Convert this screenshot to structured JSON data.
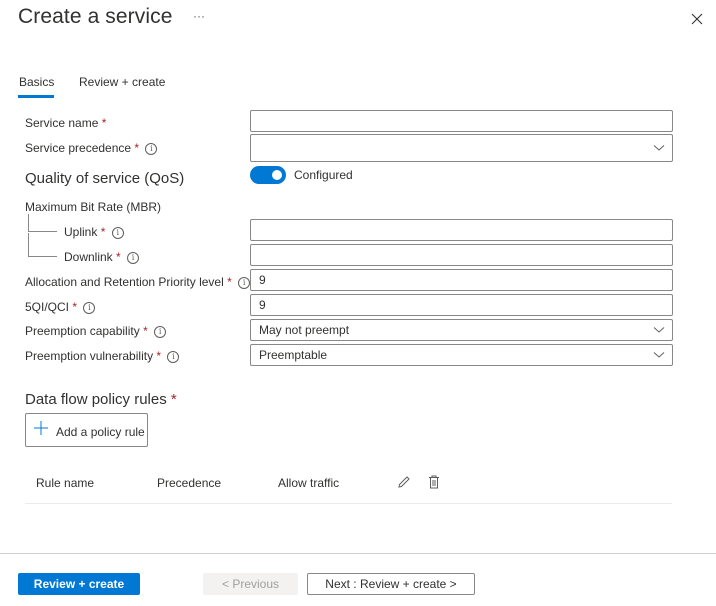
{
  "header": {
    "title": "Create a service",
    "more_label": "···",
    "close_icon": "close-icon"
  },
  "tabs": [
    {
      "label": "Basics",
      "active": true
    },
    {
      "label": "Review + create",
      "active": false
    }
  ],
  "form": {
    "service_name": {
      "label": "Service name",
      "required_mark": "*",
      "value": ""
    },
    "service_precedence": {
      "label": "Service precedence",
      "required_mark": "*",
      "value": "",
      "info_icon": "info-icon"
    },
    "qos": {
      "heading": "Quality of service (QoS)",
      "toggle_label": "Configured",
      "toggle_on": true,
      "mbr_label": "Maximum Bit Rate (MBR)",
      "uplink": {
        "label": "Uplink",
        "required_mark": "*",
        "value": ""
      },
      "downlink": {
        "label": "Downlink",
        "required_mark": "*",
        "value": ""
      },
      "arp": {
        "label": "Allocation and Retention Priority level",
        "required_mark": "*",
        "value": "9"
      },
      "qci": {
        "label": "5QI/QCI",
        "required_mark": "*",
        "value": "9"
      },
      "preemption_capability": {
        "label": "Preemption capability",
        "required_mark": "*",
        "value": "May not preempt"
      },
      "preemption_vulnerability": {
        "label": "Preemption vulnerability",
        "required_mark": "*",
        "value": "Preemptable"
      }
    },
    "policy_rules": {
      "heading": "Data flow policy rules",
      "required_mark": "*",
      "add_button_label": "Add a policy rule",
      "columns": [
        "Rule name",
        "Precedence",
        "Allow traffic"
      ],
      "row_actions": [
        "edit-icon",
        "delete-icon"
      ]
    }
  },
  "footer": {
    "review_create_label": "Review + create",
    "previous_label": "< Previous",
    "next_label": "Next : Review + create >"
  },
  "colors": {
    "accent": "#0078d4",
    "required": "#a4262c",
    "disabled_bg": "#f3f2f1"
  }
}
